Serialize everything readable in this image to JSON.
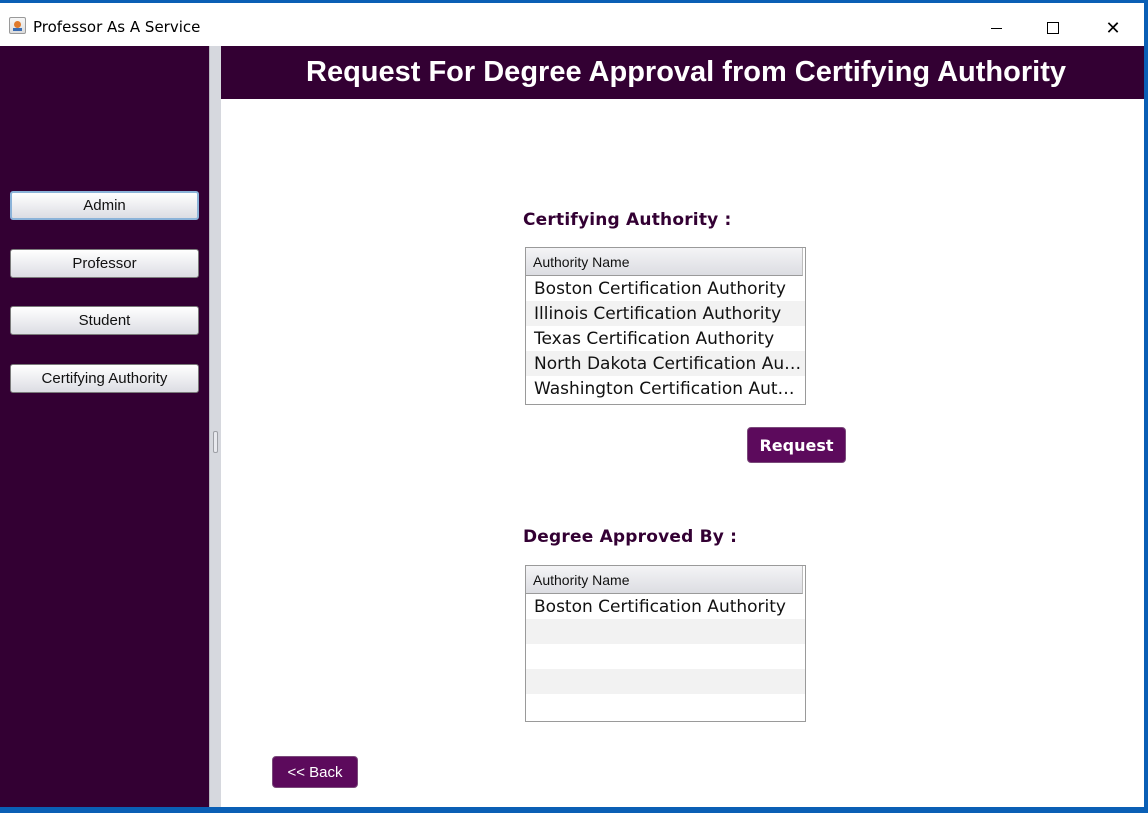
{
  "window": {
    "title": "Professor As A Service",
    "icon": "java-app-icon",
    "controls": {
      "minimize": "minimize-icon",
      "maximize": "maximize-icon",
      "close": "✕"
    }
  },
  "sidebar": {
    "buttons": [
      {
        "label": "Admin",
        "active": true
      },
      {
        "label": "Professor"
      },
      {
        "label": "Student"
      },
      {
        "label": "Certifying Authority"
      }
    ]
  },
  "header": {
    "title": "Request For Degree Approval from Certifying Authority"
  },
  "certifying": {
    "label": "Certifying Authority :",
    "column": "Authority Name",
    "rows": [
      "Boston Certification Authority",
      "Illinois Certification Authority",
      "Texas Certification Authority",
      "North Dakota Certification Authority",
      "Washington Certification Authority"
    ]
  },
  "request_button": "Request",
  "approved": {
    "label": "Degree Approved By :",
    "column": "Authority Name",
    "rows": [
      "Boston Certification Authority"
    ]
  },
  "back_button": "<< Back",
  "colors": {
    "primary": "#330033",
    "button": "#5c0a5c",
    "accent": "#0a5fb5"
  }
}
